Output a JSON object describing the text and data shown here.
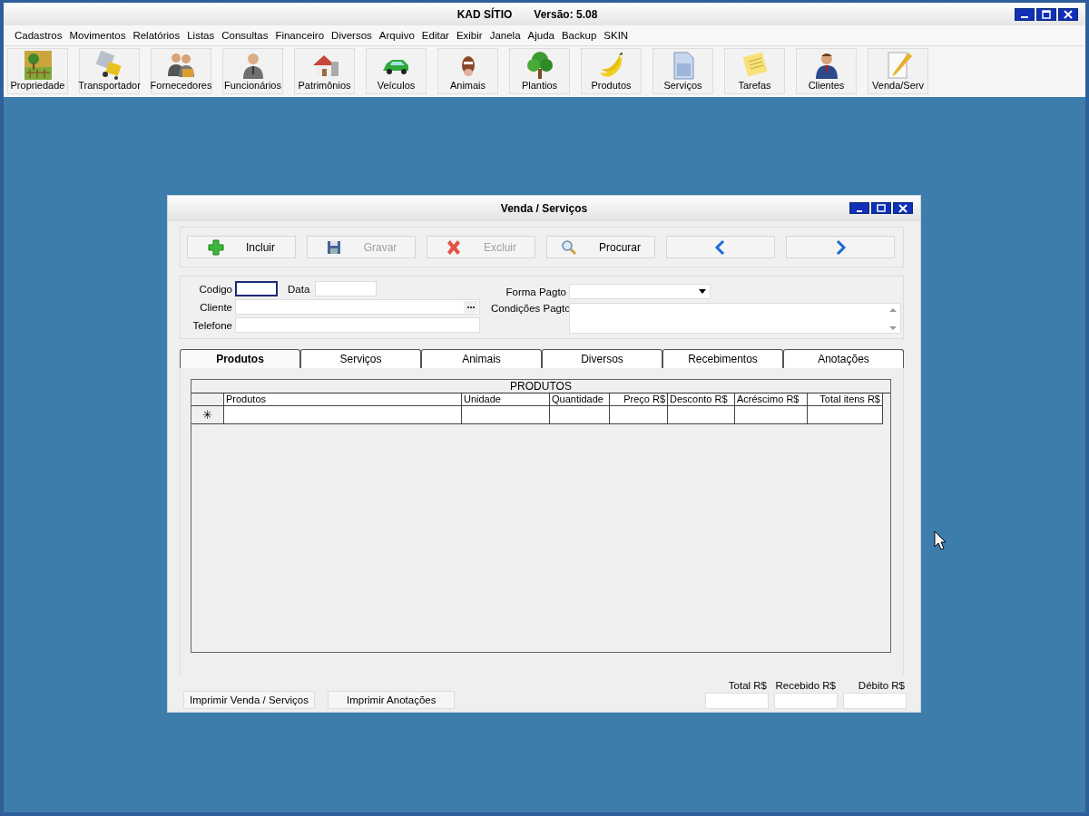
{
  "window": {
    "title": "KAD SÍTIO",
    "version": "Versão: 5.08"
  },
  "menu": [
    {
      "label": "Cadastros"
    },
    {
      "label": "Movimentos"
    },
    {
      "label": "Relatórios"
    },
    {
      "label": "Listas"
    },
    {
      "label": "Consultas"
    },
    {
      "label": "Financeiro"
    },
    {
      "label": "Diversos"
    },
    {
      "label": "Arquivo"
    },
    {
      "label": "Editar"
    },
    {
      "label": "Exibir"
    },
    {
      "label": "Janela"
    },
    {
      "label": "Ajuda"
    },
    {
      "label": "Backup"
    },
    {
      "label": "SKIN"
    }
  ],
  "toolbar": [
    {
      "label": "Propriedade",
      "kind": "farm"
    },
    {
      "label": "Transportador",
      "kind": "truck"
    },
    {
      "label": "Fornecedores",
      "kind": "people"
    },
    {
      "label": "Funcionários",
      "kind": "person"
    },
    {
      "label": "Patrimônios",
      "kind": "house"
    },
    {
      "label": "Veículos",
      "kind": "car"
    },
    {
      "label": "Animais",
      "kind": "cow"
    },
    {
      "label": "Plantios",
      "kind": "tree"
    },
    {
      "label": "Produtos",
      "kind": "banana"
    },
    {
      "label": "Serviços",
      "kind": "document"
    },
    {
      "label": "Tarefas",
      "kind": "note"
    },
    {
      "label": "Clientes",
      "kind": "client"
    },
    {
      "label": "Venda/Serv",
      "kind": "pencil"
    }
  ],
  "child_window": {
    "title": "Venda / Serviços",
    "actions": [
      {
        "label": "Incluir",
        "kind": "add",
        "disabled": false
      },
      {
        "label": "Gravar",
        "kind": "save",
        "disabled": true
      },
      {
        "label": "Excluir",
        "kind": "delete",
        "disabled": true
      },
      {
        "label": "Procurar",
        "kind": "search",
        "disabled": false
      },
      {
        "kind": "prev"
      },
      {
        "kind": "next"
      }
    ],
    "fields": {
      "codigo": {
        "label": "Codigo",
        "focused": true
      },
      "data": {
        "label": "Data"
      },
      "cliente": {
        "label": "Cliente"
      },
      "telefone": {
        "label": "Telefone"
      },
      "forma_pagto": {
        "label": "Forma Pagto"
      },
      "condicoes_pagto": {
        "label": "Condições Pagto"
      }
    },
    "tabs": [
      {
        "label": "Produtos",
        "selected": true
      },
      {
        "label": "Serviços",
        "selected": false
      },
      {
        "label": "Animais",
        "selected": false
      },
      {
        "label": "Diversos",
        "selected": false
      },
      {
        "label": "Recebimentos",
        "selected": false
      },
      {
        "label": "Anotações",
        "selected": false
      }
    ],
    "grid": {
      "title": "PRODUTOS",
      "columns": [
        "Produtos",
        "Unidade",
        "Quantidade",
        "Preço R$",
        "Desconto R$",
        "Acréscimo R$",
        "Total itens R$"
      ],
      "new_row_marker": "✳"
    },
    "print_buttons": [
      "Imprimir Venda / Serviços",
      "Imprimir Anotações"
    ],
    "totals": [
      {
        "label": "Total R$"
      },
      {
        "label": "Recebido R$"
      },
      {
        "label": "Débito R$"
      }
    ]
  }
}
